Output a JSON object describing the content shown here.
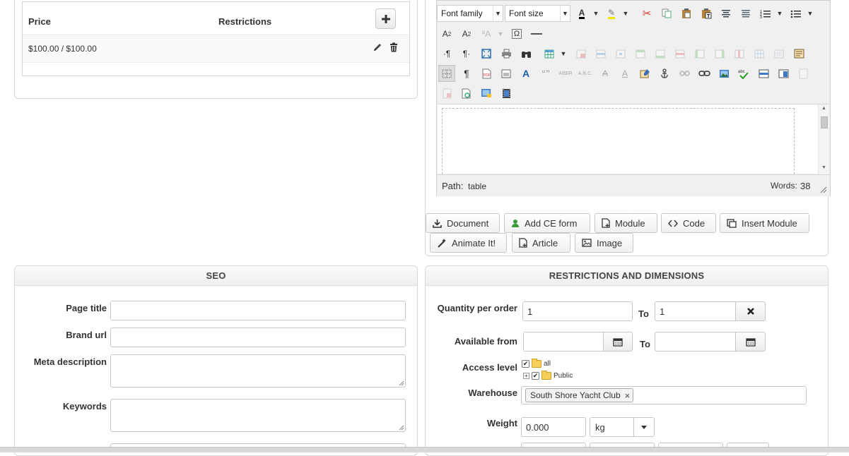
{
  "price_table": {
    "col_price": "Price",
    "col_restrictions": "Restrictions",
    "rows": [
      {
        "price": "$100.00 / $100.00"
      }
    ]
  },
  "editor": {
    "font_family": "Font family",
    "font_size": "Font size",
    "path_label": "Path:",
    "path_value": "table",
    "words_label": "Words:",
    "words_count": "38"
  },
  "editor_buttons": {
    "document": "Document",
    "add_ce_form": "Add CE form",
    "module": "Module",
    "code": "Code",
    "insert_module": "Insert Module",
    "animate_it": "Animate It!",
    "article": "Article",
    "image": "Image"
  },
  "seo": {
    "title": "SEO",
    "page_title_label": "Page title",
    "page_title_value": "",
    "brand_url_label": "Brand url",
    "brand_url_value": "",
    "meta_description_label": "Meta description",
    "keywords_label": "Keywords"
  },
  "restrictions": {
    "title": "RESTRICTIONS AND DIMENSIONS",
    "quantity_label": "Quantity per order",
    "quantity_from": "1",
    "to_label": "To",
    "quantity_to": "1",
    "available_from_label": "Available from",
    "available_from_value": "",
    "available_to_value": "",
    "access_level_label": "Access level",
    "access_tree": [
      {
        "label": "all",
        "checked": true
      },
      {
        "label": "Public",
        "checked": true
      }
    ],
    "warehouse_label": "Warehouse",
    "warehouse_tag": "South Shore Yacht Club",
    "weight_label": "Weight",
    "weight_value": "0.000",
    "weight_unit": "kg"
  },
  "colors": {
    "panel_border": "#d8d8d8",
    "check_green": "#2a9a2a",
    "scissors_red": "#d9342b",
    "add_ce_icon": "#3b9a3b"
  }
}
